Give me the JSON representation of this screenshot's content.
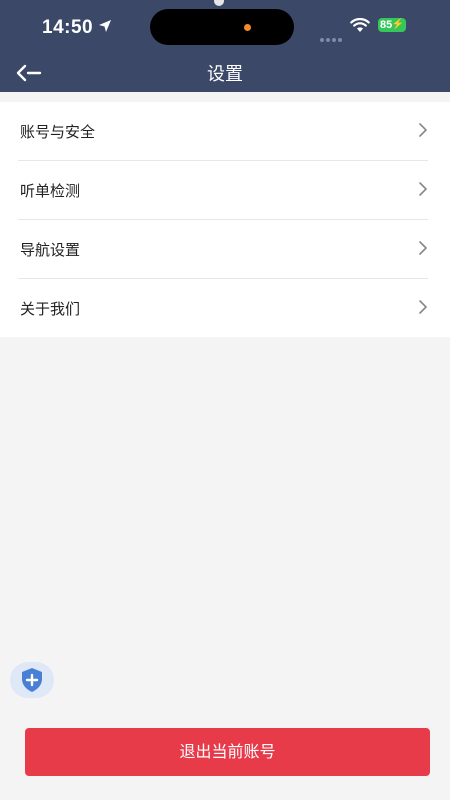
{
  "status_bar": {
    "time": "14:50",
    "battery": "85",
    "icons": [
      "location-arrow-icon",
      "signal-dots-icon",
      "wifi-icon",
      "battery-icon"
    ]
  },
  "header": {
    "title": "设置",
    "back_icon": "back-arrow-icon"
  },
  "menu": {
    "items": [
      {
        "label": "账号与安全",
        "icon": "chevron-right-icon"
      },
      {
        "label": "听单检测",
        "icon": "chevron-right-icon"
      },
      {
        "label": "导航设置",
        "icon": "chevron-right-icon"
      },
      {
        "label": "关于我们",
        "icon": "chevron-right-icon"
      }
    ]
  },
  "floating": {
    "icon": "shield-plus-icon"
  },
  "footer": {
    "logout_label": "退出当前账号"
  },
  "colors": {
    "header_bg": "#3b4868",
    "page_bg": "#f4f4f4",
    "logout_bg": "#e83b4a",
    "battery_green": "#35c759"
  }
}
